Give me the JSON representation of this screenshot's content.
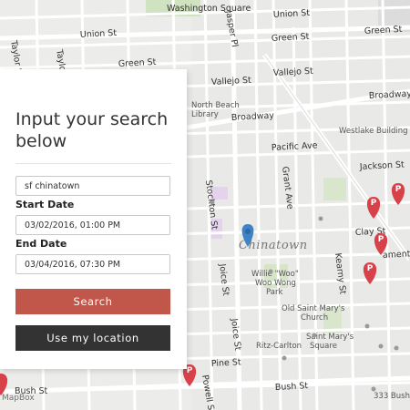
{
  "search_panel": {
    "title": "Input your search below",
    "query_value": "sf chinatown",
    "start_label": "Start Date",
    "start_value": "03/02/2016, 01:00 PM",
    "end_label": "End Date",
    "end_value": "03/04/2016, 07:30 PM",
    "search_button": "Search",
    "location_button": "Use my location"
  },
  "map": {
    "district": "Chinatown",
    "streets": {
      "washington_top": "Washington Square",
      "union_1": "Union St",
      "union_2": "Union St",
      "taylor_1": "Taylor St",
      "taylor_2": "Taylor St",
      "jasper": "Jasper Pl",
      "green_1": "Green St",
      "green_2": "Green St",
      "green_3": "Green St",
      "vallejo_1": "Vallejo St",
      "vallejo_2": "Vallejo St",
      "broadway_1": "Broadway",
      "broadway_2": "Broadway",
      "pacific": "Pacific Ave",
      "jackson": "Jackson St",
      "stockton": "Stockton St",
      "grant": "Grant Ave",
      "kearny": "Kearny St",
      "clay": "Clay St",
      "sacramento": "amento",
      "joice": "Joice St",
      "pine": "Pine St",
      "bush_1": "Bush St",
      "bush_2": "Bush St",
      "powell": "Powell St"
    },
    "places": {
      "north_beach": "North Beach",
      "north_beach_2": "Library",
      "westlake": "Westlake Building",
      "willie_1": "Willie \"Woo\"",
      "willie_2": "Woo Wong",
      "willie_3": "Park",
      "old_st_marys_1": "Old Saint Mary's",
      "old_st_marys_2": "Church",
      "st_marys_sq_1": "Saint Mary's",
      "st_marys_sq_2": "Square",
      "ritz": "Ritz-Carlton",
      "bush333": "333 Bush"
    },
    "parking_badge": "P",
    "attribution": "MapBox",
    "colors": {
      "parking_marker": "#d9414a",
      "location_marker": "#3f83c5",
      "search_button": "#c0574a",
      "location_button": "#333333"
    }
  }
}
